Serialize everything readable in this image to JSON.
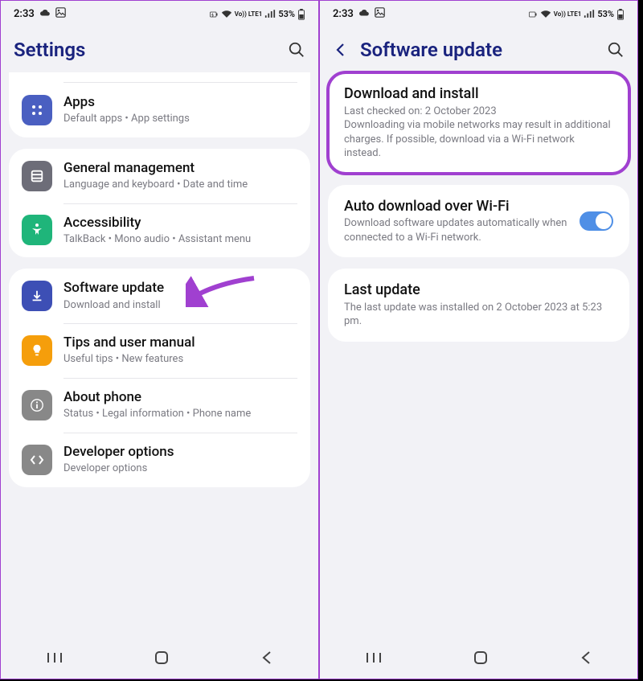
{
  "status": {
    "time": "2:33",
    "battery": "53%",
    "net": "Vo)) LTE1"
  },
  "left": {
    "title": "Settings",
    "items": {
      "apps": {
        "title": "Apps",
        "sub": "Default apps • App settings"
      },
      "general": {
        "title": "General management",
        "sub": "Language and keyboard • Date and time"
      },
      "accessibility": {
        "title": "Accessibility",
        "sub": "TalkBack • Mono audio • Assistant menu"
      },
      "software": {
        "title": "Software update",
        "sub": "Download and install"
      },
      "tips": {
        "title": "Tips and user manual",
        "sub": "Useful tips • New features"
      },
      "about": {
        "title": "About phone",
        "sub": "Status • Legal information • Phone name"
      },
      "developer": {
        "title": "Developer options",
        "sub": "Developer options"
      }
    }
  },
  "right": {
    "title": "Software update",
    "download": {
      "title": "Download and install",
      "sub": "Last checked on: 2 October 2023\nDownloading via mobile networks may result in additional charges. If possible, download via a Wi-Fi network instead."
    },
    "auto": {
      "title": "Auto download over Wi-Fi",
      "sub": "Download software updates automatically when connected to a Wi-Fi network."
    },
    "last": {
      "title": "Last update",
      "sub": "The last update was installed on 2 October 2023 at 5:23 pm."
    }
  }
}
